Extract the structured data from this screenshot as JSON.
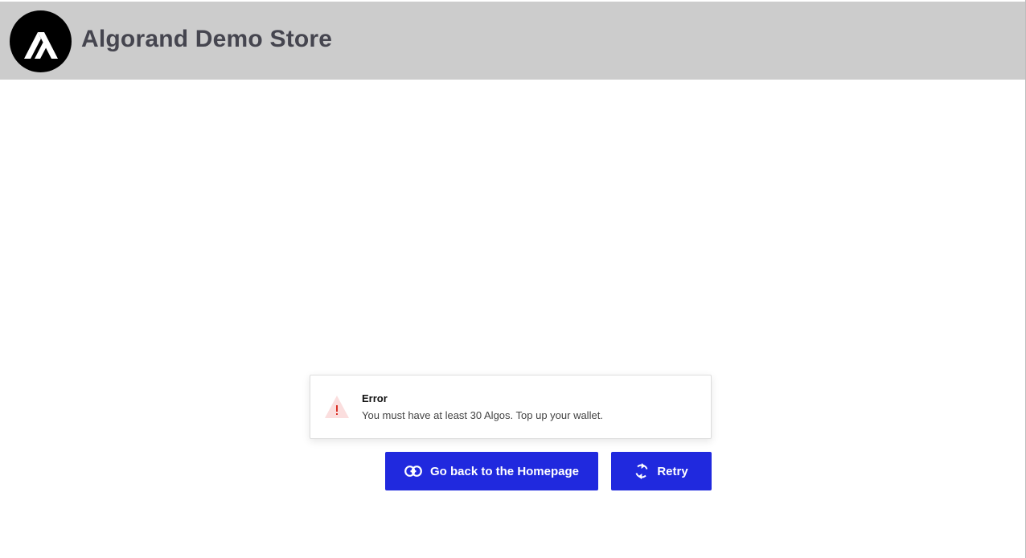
{
  "header": {
    "logo_icon": "algorand-logo-icon",
    "title": "Algorand Demo Store",
    "background": "#cccccc"
  },
  "alert": {
    "icon": "warning-triangle-icon",
    "title": "Error",
    "message": "You must have at least 30 Algos. Top up your wallet.",
    "icon_color": "#fbdede",
    "icon_mark_color": "#d93025"
  },
  "actions": {
    "home_icon": "link-icon",
    "home_label": "Go back to the Homepage",
    "retry_icon": "refresh-icon",
    "retry_label": "Retry",
    "button_color": "#2029de"
  }
}
